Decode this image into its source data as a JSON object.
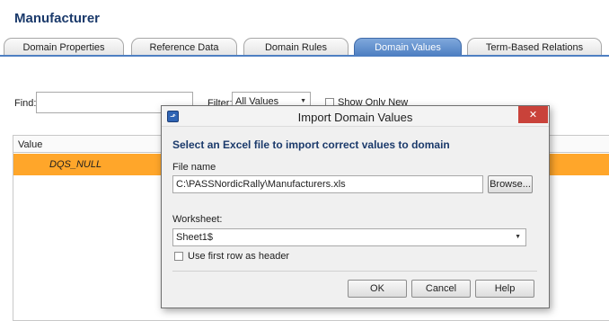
{
  "page": {
    "title": "Manufacturer"
  },
  "tabs": [
    {
      "label": "Domain Properties",
      "active": false
    },
    {
      "label": "Reference Data",
      "active": false
    },
    {
      "label": "Domain Rules",
      "active": false
    },
    {
      "label": "Domain Values",
      "active": true
    },
    {
      "label": "Term-Based Relations",
      "active": false
    }
  ],
  "toolbar": {
    "find_label": "Find:",
    "find_value": "",
    "filter_label": "Filter:",
    "filter_value": "All Values",
    "show_only_new_label": "Show Only New"
  },
  "grid": {
    "column_header": "Value",
    "rows": [
      {
        "value": "DQS_NULL",
        "highlight": "#ffa62a"
      }
    ]
  },
  "dialog": {
    "title": "Import Domain Values",
    "close_label": "✕",
    "heading": "Select an Excel file to import correct values to domain",
    "file_name_label": "File name",
    "file_name_value": "C:\\PASSNordicRally\\Manufacturers.xls",
    "browse_label": "Browse...",
    "worksheet_label": "Worksheet:",
    "worksheet_value": "Sheet1$",
    "use_first_row_label": "Use first row as header",
    "use_first_row_checked": false,
    "ok_label": "OK",
    "cancel_label": "Cancel",
    "help_label": "Help"
  },
  "colors": {
    "accent": "#4e7fc2",
    "heading": "#1b3a6b",
    "row_highlight": "#ffa62a",
    "close_button": "#c9423a"
  },
  "icons": {
    "dialog_icon": "import-icon",
    "close": "close-icon",
    "dropdown": "chevron-down-icon"
  }
}
